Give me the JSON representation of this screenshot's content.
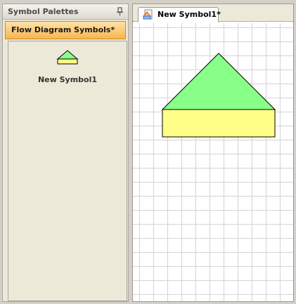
{
  "palette_panel": {
    "title": "Symbol Palettes",
    "pin_icon": "pin-icon",
    "active_palette": "Flow Diagram Symbols*",
    "symbols": [
      {
        "name": "New Symbol1"
      }
    ]
  },
  "editor": {
    "tabs": [
      {
        "label": "New Symbol1*",
        "icon": "symbol-document-icon"
      }
    ],
    "symbol": {
      "parts": [
        "triangle",
        "rectangle"
      ],
      "colors": {
        "triangle": "#88ff88",
        "rectangle": "#ffff88",
        "outline": "#000000"
      }
    },
    "grid": true
  },
  "colors": {
    "active_palette_tab": "#f8b64e",
    "panel_background": "#ece9d8",
    "canvas_background": "#ffffff"
  }
}
